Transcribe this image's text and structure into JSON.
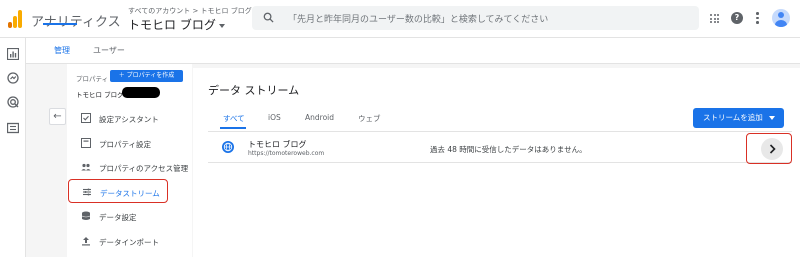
{
  "topbar": {
    "app_name": "アナリティクス",
    "account_path": "すべてのアカウント > トモヒロ ブログ",
    "property_name": "トモヒロ ブログ",
    "search_placeholder": "「先月と昨年同月のユーザー数の比較」と検索してみてください",
    "help_glyph": "?"
  },
  "tabs": [
    {
      "label": "管理",
      "active": true
    },
    {
      "label": "ユーザー",
      "active": false
    }
  ],
  "nav": {
    "property_label": "プロパティ",
    "create_property_label": "＋ プロパティを作成",
    "property_name": "トモヒロ ブログ",
    "back_glyph": "←",
    "items": [
      {
        "label": "設定アシスタント",
        "icon": "checklist-icon"
      },
      {
        "label": "プロパティ設定",
        "icon": "settings-square-icon"
      },
      {
        "label": "プロパティのアクセス管理",
        "icon": "people-icon"
      },
      {
        "label": "データストリーム",
        "icon": "data-stream-icon",
        "selected": true
      },
      {
        "label": "データ設定",
        "icon": "database-icon"
      },
      {
        "label": "データインポート",
        "icon": "upload-icon"
      }
    ]
  },
  "main": {
    "title": "データ ストリーム",
    "filters": [
      {
        "label": "すべて",
        "active": true
      },
      {
        "label": "iOS",
        "active": false
      },
      {
        "label": "Android",
        "active": false
      },
      {
        "label": "ウェブ",
        "active": false
      }
    ],
    "add_stream_label": "ストリームを追加",
    "stream": {
      "name": "トモヒロ ブログ",
      "url": "https://tomoteroweb.com",
      "status": "過去 48 時間に受信したデータはありません。",
      "chevron_glyph": "›"
    }
  },
  "colors": {
    "accent": "#1a73e8",
    "highlight": "#d93025",
    "logo": [
      "#f9ab00",
      "#e37400"
    ]
  }
}
